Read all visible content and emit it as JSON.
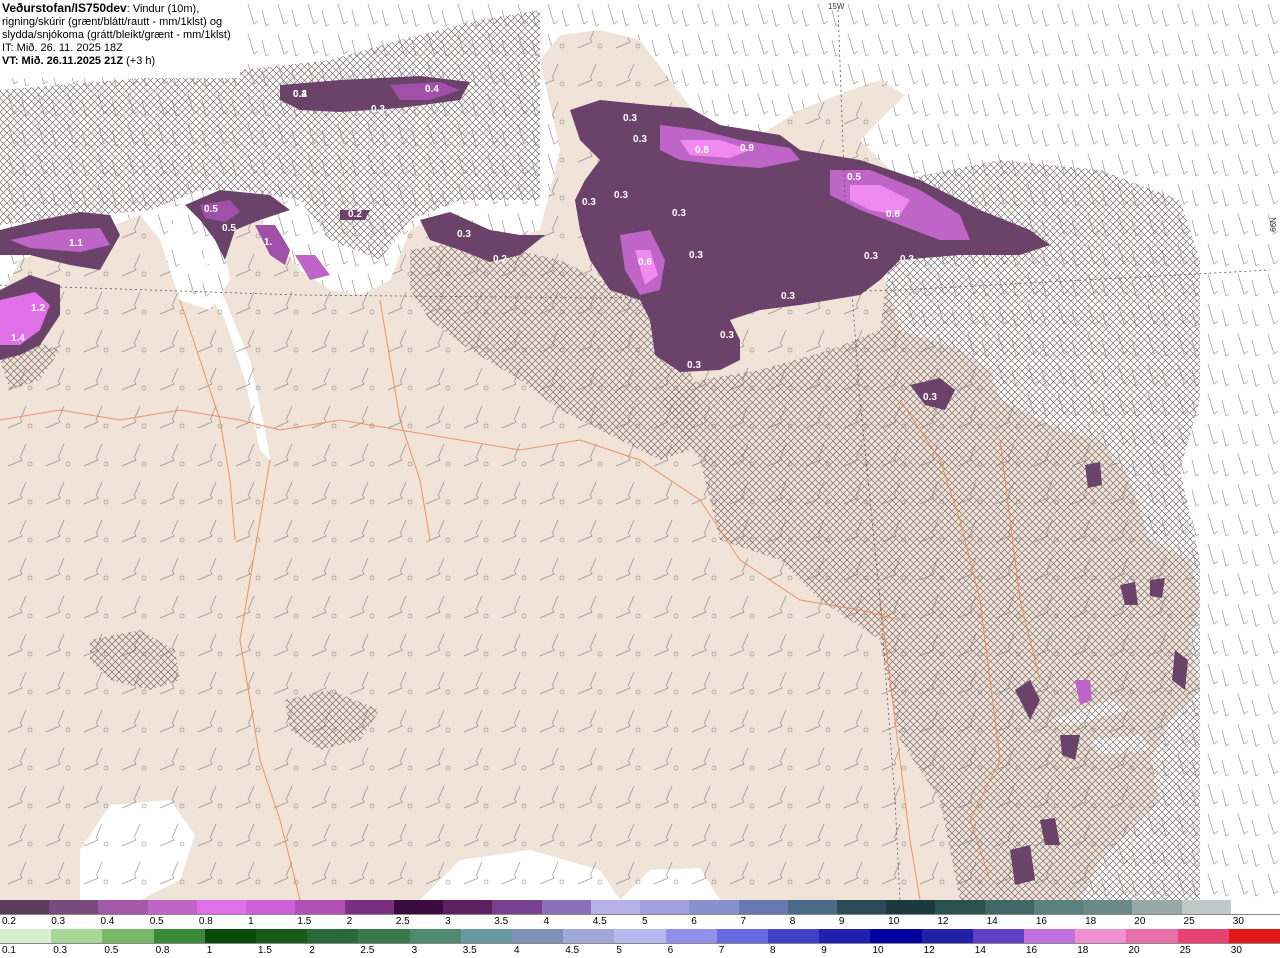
{
  "header": {
    "product": "Veðurstofan/IS750dev",
    "description_first": ": Vindur (10m),",
    "description_lines": [
      "rigning/skúrir (grænt/blátt/rautt - mm/1klst) og",
      "slydda/snjókoma (grátt/bleikt/grænt - mm/1klst)"
    ],
    "init_time": "IT: Mið. 26. 11. 2025 18Z",
    "valid_time": "VT: Mið. 26.11.2025 21Z",
    "lead": "(+3 h)"
  },
  "grid_labels": {
    "longitude": "15W",
    "latitude": "66N"
  },
  "precip_labels": [
    {
      "text": "0.2"
    },
    {
      "text": "0.3"
    },
    {
      "text": "0.4"
    },
    {
      "text": "0.4"
    },
    {
      "text": "0.2"
    },
    {
      "text": "0.5"
    },
    {
      "text": "1.1"
    },
    {
      "text": "1."
    },
    {
      "text": "0.5"
    },
    {
      "text": "1.2"
    },
    {
      "text": "1.4"
    },
    {
      "text": "0.3"
    },
    {
      "text": "0.2"
    },
    {
      "text": "0.3"
    },
    {
      "text": "0.3"
    },
    {
      "text": "0.8"
    },
    {
      "text": "0.9"
    },
    {
      "text": "0.3"
    },
    {
      "text": "0.3"
    },
    {
      "text": "0.3"
    },
    {
      "text": "0.6"
    },
    {
      "text": "0.3"
    },
    {
      "text": "0.5"
    },
    {
      "text": "0.8"
    },
    {
      "text": "0.3"
    },
    {
      "text": "0.3"
    },
    {
      "text": "0.3"
    },
    {
      "text": "0.3"
    },
    {
      "text": "0.3"
    },
    {
      "text": "0.3"
    }
  ],
  "legend_snow": {
    "labels": [
      "0.2",
      "0.3",
      "0.4",
      "0.5",
      "0.8",
      "1",
      "1.5",
      "2",
      "2.5",
      "3",
      "3.5",
      "4",
      "4.5",
      "5",
      "6",
      "7",
      "8",
      "9",
      "10",
      "12",
      "14",
      "16",
      "18",
      "20",
      "25",
      "30"
    ],
    "colors": [
      "#5a3b5c",
      "#7a4a7e",
      "#a25aa8",
      "#c065c8",
      "#e070e8",
      "#d060d8",
      "#b050b8",
      "#7a3080",
      "#3a0a40",
      "#5a2060",
      "#7a4090",
      "#8a70b8",
      "#b8b0e8",
      "#a0a0e0",
      "#8890d0",
      "#6878b0",
      "#4a6a88",
      "#2a4a58",
      "#1a3a40",
      "#2a5050",
      "#406868",
      "#5a8080",
      "#6a8a88",
      "#98a8a8",
      "#c0c8c8",
      "#ffffff"
    ]
  },
  "legend_rain": {
    "labels": [
      "0.1",
      "0.3",
      "0.5",
      "0.8",
      "1",
      "1.5",
      "2",
      "2.5",
      "3",
      "3.5",
      "4",
      "4.5",
      "5",
      "6",
      "7",
      "8",
      "9",
      "10",
      "12",
      "14",
      "16",
      "18",
      "20",
      "25",
      "30"
    ],
    "colors": [
      "#d8f0d0",
      "#a8d898",
      "#78b868",
      "#3a8a3a",
      "#0a4a0a",
      "#1a5a1a",
      "#2a6a3a",
      "#3a7a4a",
      "#508a70",
      "#6898a0",
      "#8090b8",
      "#a0a8d8",
      "#b8b8f0",
      "#9090e8",
      "#6a6ae0",
      "#4040c8",
      "#2020b0",
      "#0000a0",
      "#2020a8",
      "#6040c0",
      "#c070e0",
      "#f090d0",
      "#e870a8",
      "#e84070",
      "#e01818"
    ]
  }
}
